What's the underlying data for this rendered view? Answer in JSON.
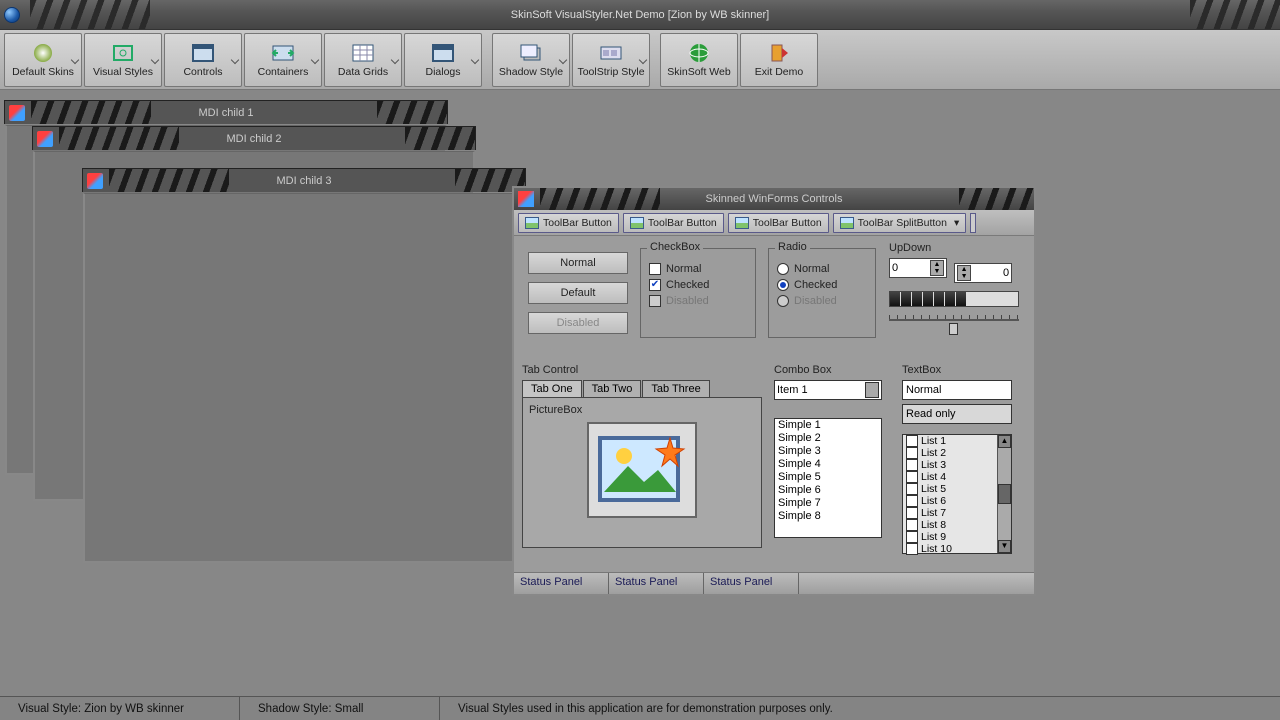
{
  "window_title": "SkinSoft VisualStyler.Net Demo [Zion by WB skinner]",
  "toolbar": [
    {
      "label": "Default Skins",
      "dropdown": true
    },
    {
      "label": "Visual Styles",
      "dropdown": true
    },
    {
      "label": "Controls",
      "dropdown": true
    },
    {
      "label": "Containers",
      "dropdown": true
    },
    {
      "label": "Data Grids",
      "dropdown": true
    },
    {
      "label": "Dialogs",
      "dropdown": true
    },
    {
      "label": "Shadow Style",
      "dropdown": true
    },
    {
      "label": "ToolStrip Style",
      "dropdown": true
    },
    {
      "label": "SkinSoft Web",
      "dropdown": false
    },
    {
      "label": "Exit Demo",
      "dropdown": false
    }
  ],
  "mdi_children": [
    "MDI child 1",
    "MDI child 2",
    "MDI child 3"
  ],
  "controls_window": {
    "title": "Skinned WinForms Controls",
    "toolbar_buttons": [
      "ToolBar Button",
      "ToolBar Button",
      "ToolBar Button",
      "ToolBar SplitButton"
    ],
    "buttons": {
      "normal": "Normal",
      "default": "Default",
      "disabled": "Disabled"
    },
    "checkbox_group": {
      "title": "CheckBox",
      "normal": "Normal",
      "checked": "Checked",
      "disabled": "Disabled"
    },
    "radio_group": {
      "title": "Radio",
      "normal": "Normal",
      "checked": "Checked",
      "disabled": "Disabled"
    },
    "updown_label": "UpDown",
    "updown_value1": "0",
    "updown_value2": "0",
    "tab_label": "Tab Control",
    "tabs": [
      "Tab One",
      "Tab Two",
      "Tab Three"
    ],
    "picturebox_label": "PictureBox",
    "combo_label": "Combo Box",
    "combo_value": "Item 1",
    "simple_list": [
      "Simple 1",
      "Simple 2",
      "Simple 3",
      "Simple 4",
      "Simple 5",
      "Simple 6",
      "Simple 7",
      "Simple 8"
    ],
    "textbox_label": "TextBox",
    "textbox_normal": "Normal",
    "textbox_readonly": "Read only",
    "checklist": [
      "List 1",
      "List 2",
      "List 3",
      "List 4",
      "List 5",
      "List 6",
      "List 7",
      "List 8",
      "List 9",
      "List 10"
    ],
    "status_panels": [
      "Status Panel",
      "Status Panel",
      "Status Panel"
    ]
  },
  "app_status": {
    "style": "Visual Style: Zion by WB skinner",
    "shadow": "Shadow Style: Small",
    "note": "Visual Styles used in this application are for demonstration purposes only."
  }
}
